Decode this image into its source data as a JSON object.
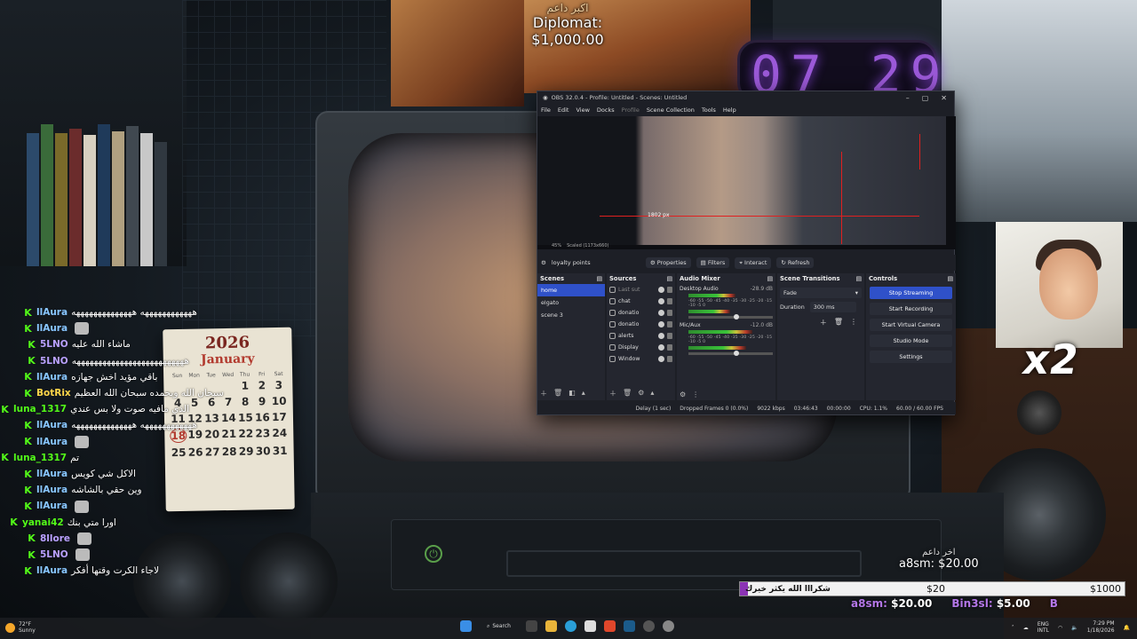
{
  "overlay": {
    "top_donation": {
      "label_ar": "اكبر داعم",
      "text": "Diplomat: $1,000.00"
    },
    "clock_digits": "07 29",
    "calendar": {
      "year": "2026",
      "month": "January",
      "weekdays": [
        "Sun",
        "Mon",
        "Tue",
        "Wed",
        "Thu",
        "Fri",
        "Sat"
      ],
      "dates": [
        "",
        "",
        "",
        "",
        "1",
        "2",
        "3",
        "4",
        "5",
        "6",
        "7",
        "8",
        "9",
        "10",
        "11",
        "12",
        "13",
        "14",
        "15",
        "16",
        "17",
        "18",
        "19",
        "20",
        "21",
        "22",
        "23",
        "24",
        "25",
        "26",
        "27",
        "28",
        "29",
        "30",
        "31"
      ]
    },
    "cam_multiplier": "x2",
    "recent_donor": {
      "label_ar": "اخر داعم",
      "text": "a8sm: $20.00"
    },
    "goal": {
      "message": "شكرااا الله يكثر خيرك",
      "current": "$20",
      "target": "$1000",
      "progress": 0.02
    },
    "ticker": [
      {
        "name": "a8sm:",
        "amount": "$20.00"
      },
      {
        "name": "Bin3sl:",
        "amount": "$5.00"
      },
      {
        "name": "B",
        "amount": ""
      }
    ]
  },
  "chat": {
    "messages": [
      {
        "user": "llAura",
        "color": "#88c6ff",
        "text": "ههههههههههههه ههههههههههههههه"
      },
      {
        "user": "llAura",
        "color": "#88c6ff",
        "text": ""
      },
      {
        "user": "5LNO",
        "color": "#b9a0ff",
        "text": "ماشاء الله عليه"
      },
      {
        "user": "5LNO",
        "color": "#b9a0ff",
        "text": "ههههههههههههههههههههههههههه"
      },
      {
        "user": "llAura",
        "color": "#88c6ff",
        "text": "باقي مؤيد اخش جهازه"
      },
      {
        "user": "BotRix",
        "color": "#ffd64a",
        "text": "سبحان الله وبحمده سبحان الله العظيم"
      },
      {
        "user": "luna_1317",
        "color": "#53fc18",
        "text": "الذي مافيه صوت ولا بس عندي"
      },
      {
        "user": "llAura",
        "color": "#88c6ff",
        "text": "ههههههههههههه ههههههههههههههه"
      },
      {
        "user": "llAura",
        "color": "#88c6ff",
        "text": ""
      },
      {
        "user": "luna_1317",
        "color": "#53fc18",
        "text": "تم"
      },
      {
        "user": "llAura",
        "color": "#88c6ff",
        "text": "الاكل شي كويس"
      },
      {
        "user": "llAura",
        "color": "#88c6ff",
        "text": "وين حقي بالشاشه"
      },
      {
        "user": "llAura",
        "color": "#88c6ff",
        "text": ""
      },
      {
        "user": "yanai42",
        "color": "#53fc18",
        "text": "اورا متي بنك"
      },
      {
        "user": "8llore",
        "color": "#b9a0ff",
        "text": ""
      },
      {
        "user": "5LNO",
        "color": "#b9a0ff",
        "text": ""
      },
      {
        "user": "llAura",
        "color": "#88c6ff",
        "text": "لاجاء الكرت وقتها أفكر"
      }
    ]
  },
  "obs": {
    "title": "OBS 32.0.4 - Profile: Untitled - Scenes: Untitled",
    "menu": [
      "File",
      "Edit",
      "View",
      "Docks",
      "Profile",
      "Scene Collection",
      "Tools",
      "Help"
    ],
    "preview_px_label": "1802 px",
    "preview_zoom": "45%",
    "preview_scaled": "Scaled (1173x660)",
    "source_name": "loyalty points",
    "toolbar": {
      "properties": "Properties",
      "filters": "Filters",
      "interact": "Interact",
      "refresh": "Refresh"
    },
    "scenes": {
      "title": "Scenes",
      "items": [
        "home",
        "elgato",
        "scene 3"
      ],
      "selected": 0
    },
    "sources": {
      "title": "Sources",
      "items": [
        "Last sut",
        "chat",
        "donatio",
        "donatio",
        "alerts",
        "Display",
        "Window"
      ]
    },
    "mixer": {
      "title": "Audio Mixer",
      "channels": [
        {
          "name": "Desktop Audio",
          "db": "-28.9 dB",
          "level": 0.62
        },
        {
          "name": "Mic/Aux",
          "db": "-12.0 dB",
          "level": 0.85
        }
      ],
      "scale": "-60 -55 -50 -45 -40 -35 -30 -25 -20 -15 -10 -5 0"
    },
    "transitions": {
      "title": "Scene Transitions",
      "type": "Fade",
      "duration_label": "Duration",
      "duration": "300 ms"
    },
    "controls": {
      "title": "Controls",
      "stop_streaming": "Stop Streaming",
      "start_recording": "Start Recording",
      "start_virtual_camera": "Start Virtual Camera",
      "studio_mode": "Studio Mode",
      "settings": "Settings"
    },
    "status": {
      "delay": "Delay (1 sec)",
      "dropped": "Dropped Frames 0 (0.0%)",
      "bitrate": "9022 kbps",
      "stream_time": "03:46:43",
      "rec_time": "00:00:00",
      "cpu": "CPU: 1.1%",
      "fps": "60.00 / 60.00 FPS"
    }
  },
  "taskbar": {
    "weather_temp": "72°F",
    "weather_desc": "Sunny",
    "search": "Search",
    "lang": "ENG",
    "region": "INTL",
    "time": "7:29 PM",
    "date": "1/18/2026"
  }
}
